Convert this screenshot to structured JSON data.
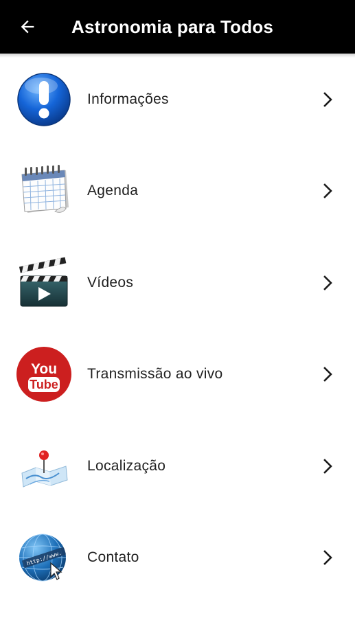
{
  "app_bar": {
    "title": "Astronomia para Todos",
    "back_icon": "arrow-left-icon",
    "background": "#000000",
    "foreground": "#ffffff"
  },
  "menu": {
    "items": [
      {
        "label": "Informações",
        "icon": "info-icon"
      },
      {
        "label": "Agenda",
        "icon": "calendar-icon"
      },
      {
        "label": "Vídeos",
        "icon": "clapperboard-icon"
      },
      {
        "label": "Transmissão ao vivo",
        "icon": "youtube-icon"
      },
      {
        "label": "Localização",
        "icon": "map-pin-icon"
      },
      {
        "label": "Contato",
        "icon": "globe-web-icon"
      }
    ],
    "chevron_icon": "chevron-right-icon"
  },
  "youtube_logo": {
    "top": "You",
    "bottom": "Tube"
  },
  "web_globe_text": "http://www."
}
